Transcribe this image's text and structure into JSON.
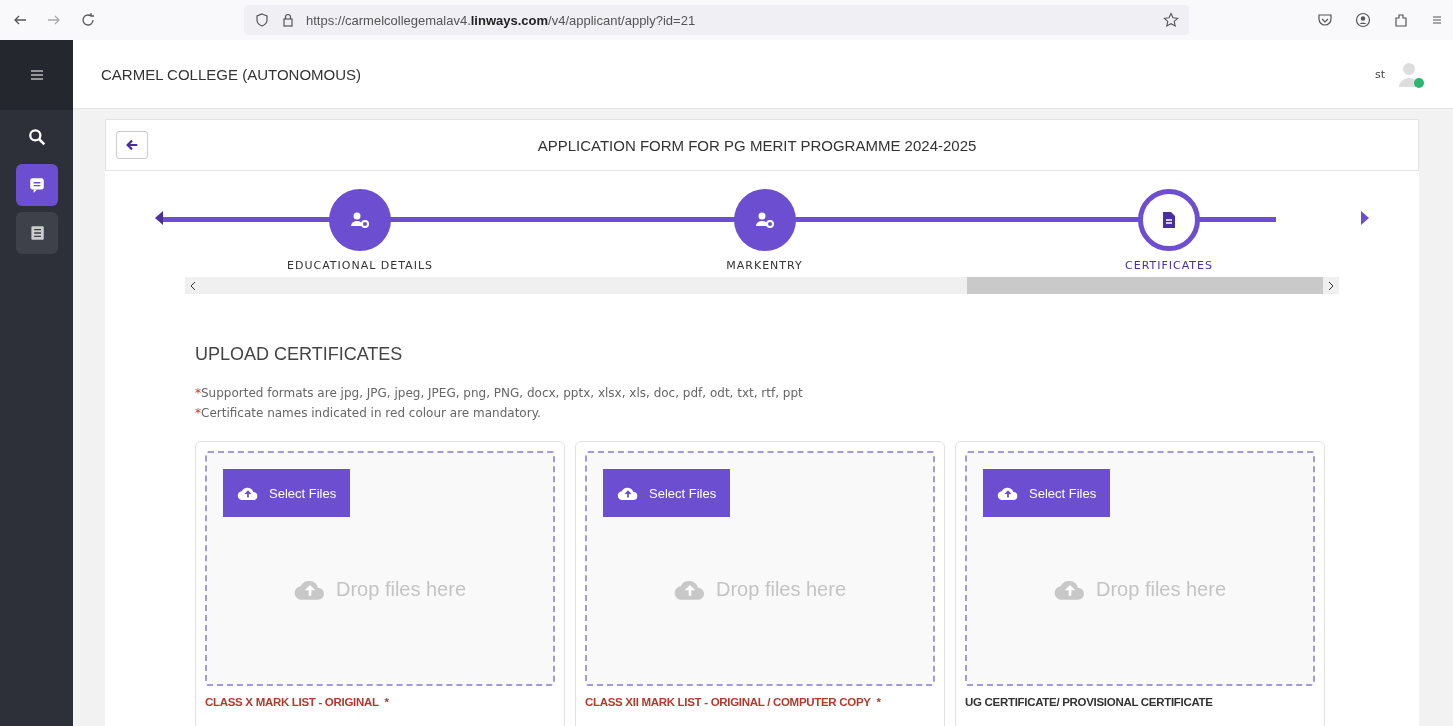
{
  "browser": {
    "url_prefix": "https://carmelcollegemalav4.",
    "url_domain": "linways.com",
    "url_suffix": "/v4/applicant/apply?id=21"
  },
  "sidebar": {
    "items": [
      {
        "kind": "search",
        "selected": false
      },
      {
        "kind": "chat",
        "selected": true
      },
      {
        "kind": "list",
        "selected": false
      }
    ]
  },
  "header": {
    "title": "CARMEL COLLEGE (AUTONOMOUS)",
    "user": "st"
  },
  "form": {
    "title": "APPLICATION FORM FOR PG MERIT PROGRAMME 2024-2025",
    "steps": [
      {
        "label": "EDUCATIONAL DETAILS",
        "kind": "person",
        "selected": false
      },
      {
        "label": "MARKENTRY",
        "kind": "person",
        "selected": false
      },
      {
        "label": "CERTIFICATES",
        "kind": "document",
        "selected": true
      }
    ],
    "section_title": "UPLOAD CERTIFICATES",
    "notes": [
      {
        "mark": "*",
        "text": "Supported formats are jpg, JPG, jpeg, JPEG, png, PNG, docx, pptx, xlsx, xls, doc, pdf, odt, txt, rtf, ppt"
      },
      {
        "mark": "*",
        "text": "Certificate names indicated in red colour are mandatory."
      }
    ],
    "uploads": [
      {
        "button": "Select Files",
        "drop": "Drop files here",
        "name": "CLASS X MARK LIST - ORIGINAL",
        "mandatory": true,
        "mark": "*"
      },
      {
        "button": "Select Files",
        "drop": "Drop files here",
        "name": "CLASS XII MARK LIST - ORIGINAL / COMPUTER COPY",
        "mandatory": true,
        "mark": "*"
      },
      {
        "button": "Select Files",
        "drop": "Drop files here",
        "name": "UG CERTIFICATE/ PROVISIONAL CERTIFICATE",
        "mandatory": false
      }
    ]
  }
}
